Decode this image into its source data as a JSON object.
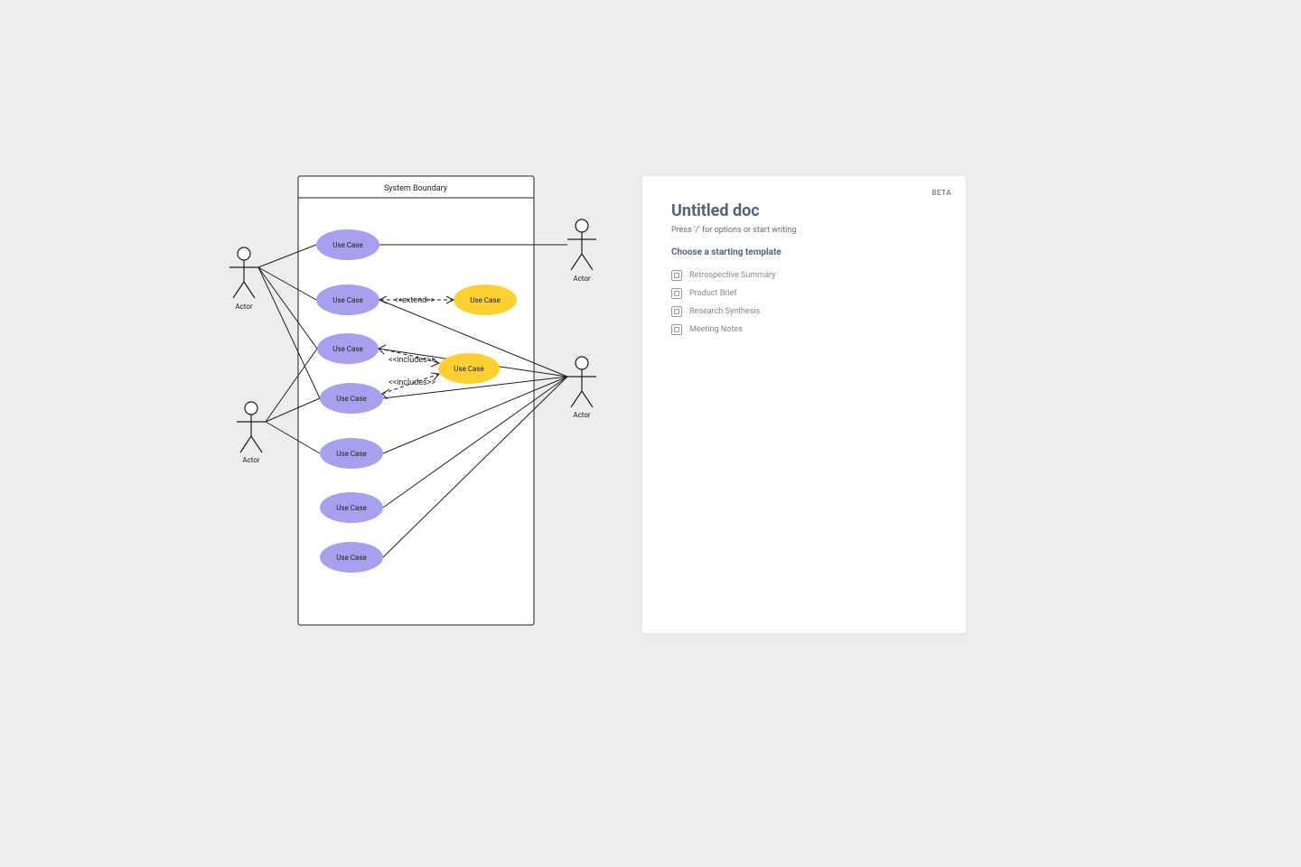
{
  "diagram": {
    "boundary_title": "System Boundary",
    "actors": [
      {
        "id": "a1",
        "label": "Actor"
      },
      {
        "id": "a2",
        "label": "Actor"
      },
      {
        "id": "a3",
        "label": "Actor"
      },
      {
        "id": "a4",
        "label": "Actor"
      }
    ],
    "use_cases": [
      {
        "id": "uc1",
        "label": "Use Case",
        "color": "purple"
      },
      {
        "id": "uc2",
        "label": "Use Case",
        "color": "purple"
      },
      {
        "id": "uc3",
        "label": "Use Case",
        "color": "yellow"
      },
      {
        "id": "uc4",
        "label": "Use Case",
        "color": "purple"
      },
      {
        "id": "uc5",
        "label": "Use Case",
        "color": "yellow"
      },
      {
        "id": "uc6",
        "label": "Use Case",
        "color": "purple"
      },
      {
        "id": "uc7",
        "label": "Use Case",
        "color": "purple"
      },
      {
        "id": "uc8",
        "label": "Use Case",
        "color": "purple"
      },
      {
        "id": "uc9",
        "label": "Use Case",
        "color": "purple"
      }
    ],
    "relations": {
      "extend": "<<extend>>",
      "includes_a": "<<includes>>",
      "includes_b": "<<includes>>"
    }
  },
  "panel": {
    "badge": "BETA",
    "title": "Untitled doc",
    "subtitle": "Press '/' for options or start writing",
    "templates_heading": "Choose a starting template",
    "templates": [
      {
        "label": "Retrospective Summary"
      },
      {
        "label": "Product Brief"
      },
      {
        "label": "Research Synthesis"
      },
      {
        "label": "Meeting Notes"
      }
    ]
  }
}
